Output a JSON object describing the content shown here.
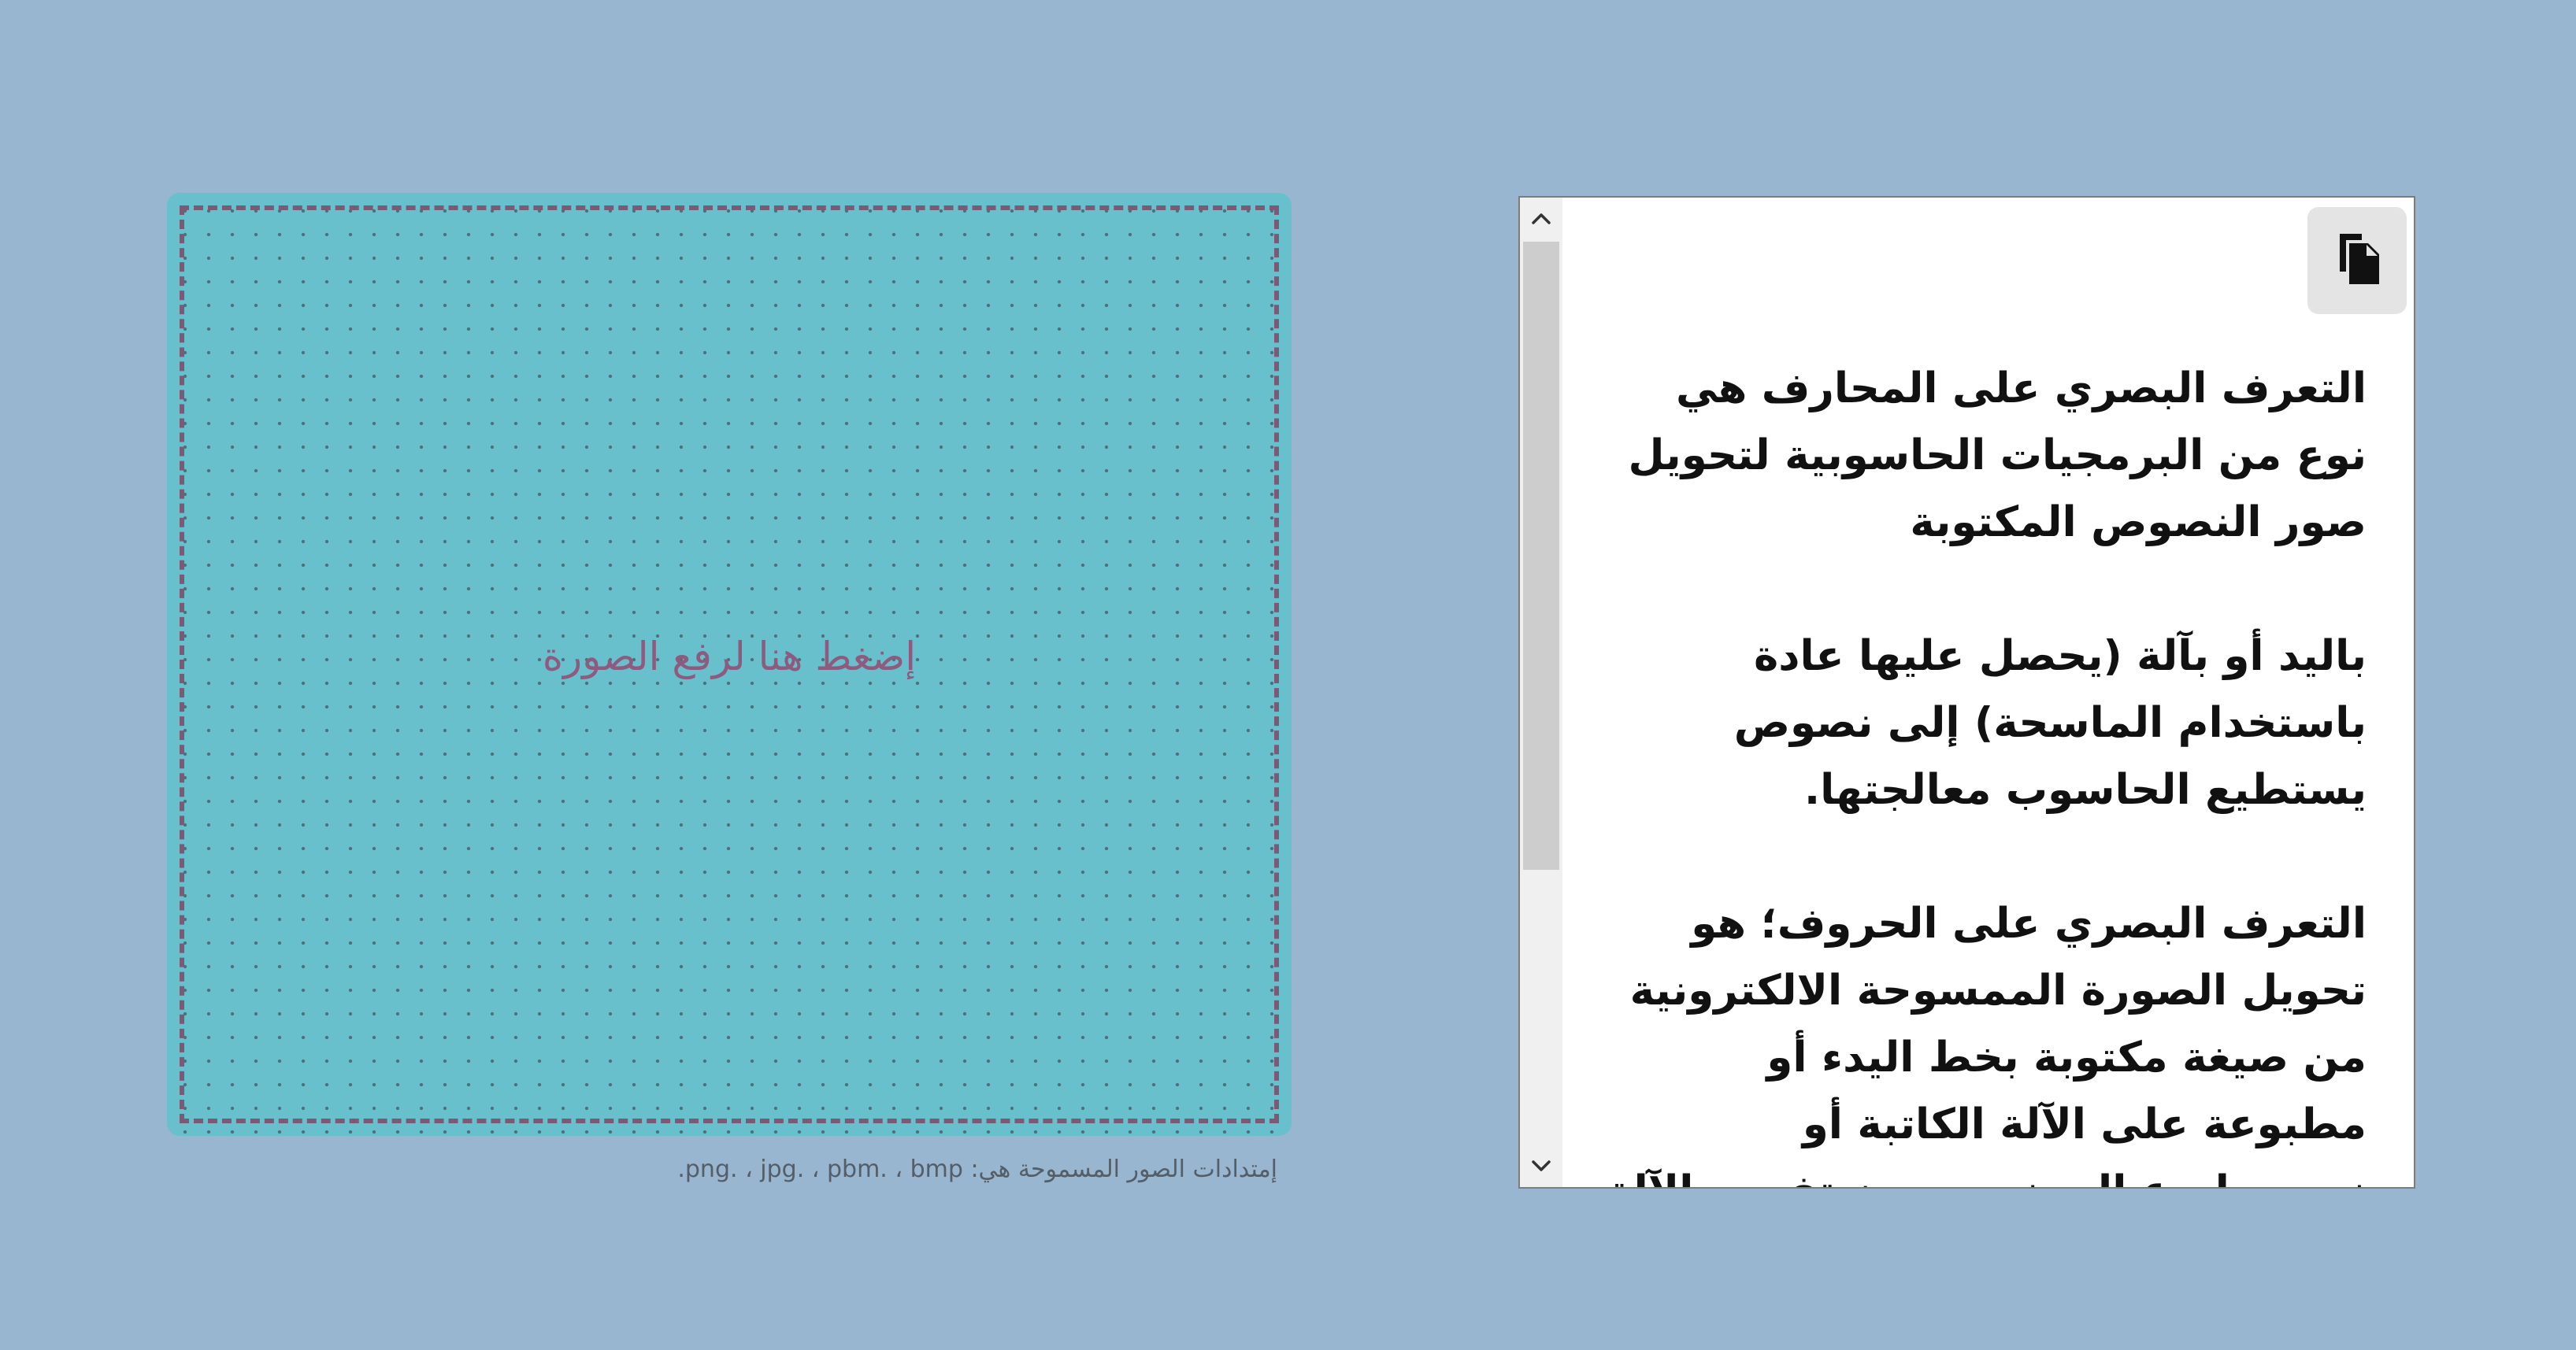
{
  "upload": {
    "label": "إضغط هنا لرفع الصورة",
    "hint": "إمتدادات الصور المسموحة هي: png. ، jpg. ، pbm. ، bmp."
  },
  "result": {
    "text": "التعرف البصري على المحارف هي نوع من البرمجيات الحاسوبية لتحويل صور النصوص المكتوبة\n\nباليد أو بآلة (يحصل عليها عادة باستخدام الماسحة) إلى نصوص يستطيع الحاسوب معالجتها.\n\nالتعرف البصري على الحروف؛ هو تحويل الصورة الممسوحة الالكترونية من صيغة مكتوبة بخط اليدء أو مطبوعة على الآلة الكاتبة أو\nنص مطبوع إلى نص مرمز تفهمه الآلة",
    "scroll_position": 0,
    "copy_icon": "copy-icon"
  },
  "colors": {
    "page_background": "#98b6d0",
    "upload_background": "#69c0cd",
    "upload_border": "#7a5a74",
    "upload_label": "#8e5a7e"
  }
}
